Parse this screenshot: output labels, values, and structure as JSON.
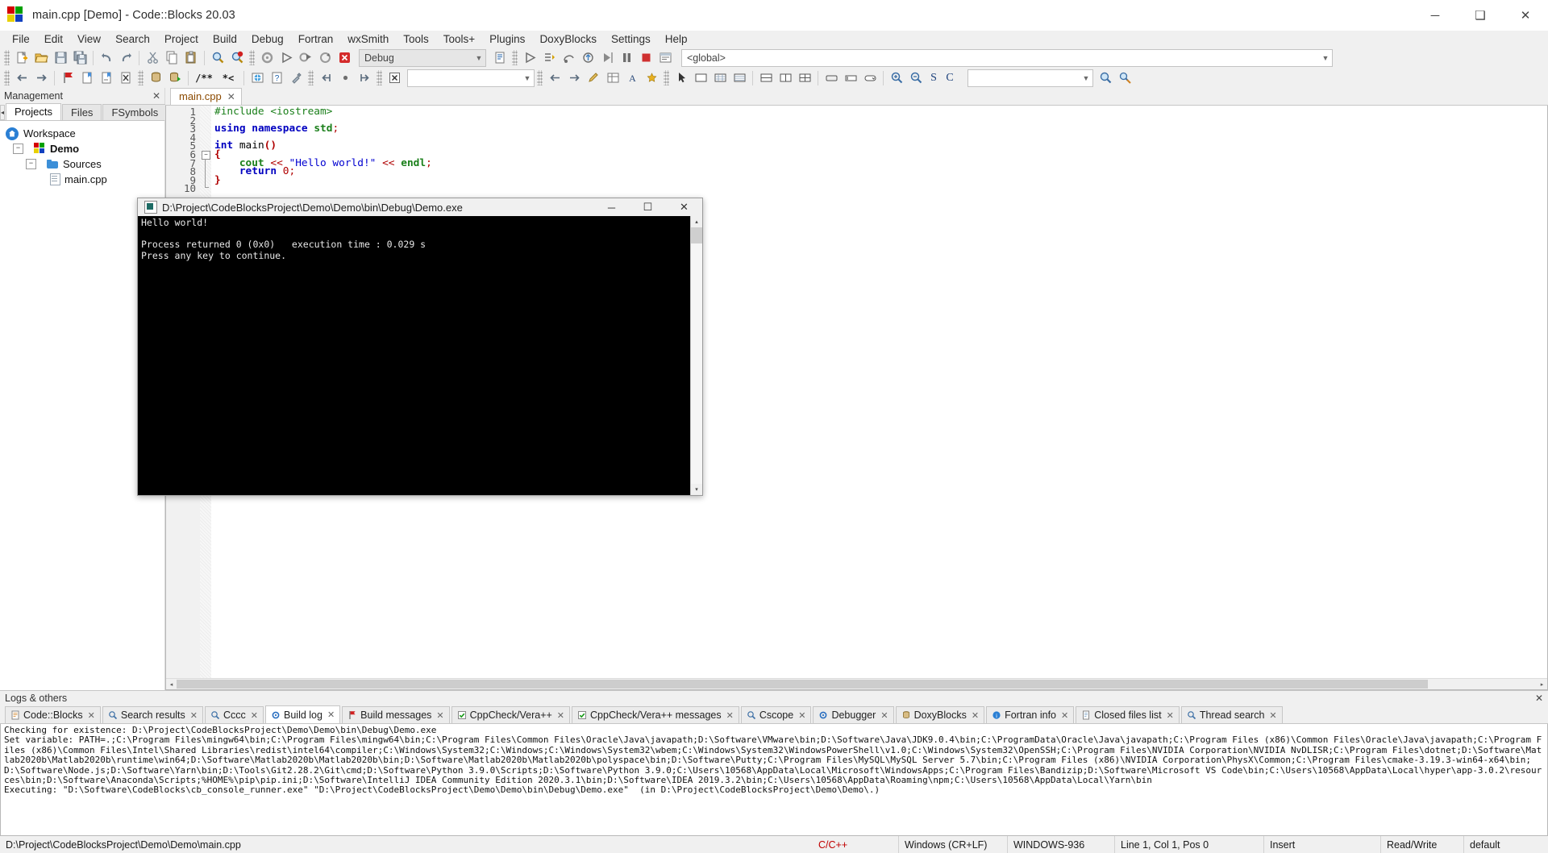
{
  "window": {
    "title": "main.cpp [Demo] - Code::Blocks 20.03",
    "app_icon": "codeblocks-logo-icon",
    "minimize_label": "─",
    "maximize_label": "❑",
    "close_label": "✕"
  },
  "menubar": {
    "items": [
      {
        "label": "File"
      },
      {
        "label": "Edit"
      },
      {
        "label": "View"
      },
      {
        "label": "Search"
      },
      {
        "label": "Project"
      },
      {
        "label": "Build"
      },
      {
        "label": "Debug"
      },
      {
        "label": "Fortran"
      },
      {
        "label": "wxSmith"
      },
      {
        "label": "Tools"
      },
      {
        "label": "Tools+"
      },
      {
        "label": "Plugins"
      },
      {
        "label": "DoxyBlocks"
      },
      {
        "label": "Settings"
      },
      {
        "label": "Help"
      }
    ]
  },
  "toolbar": {
    "build_target": "Debug",
    "scope": "<global>",
    "search_value": "",
    "goto_value": "",
    "row1_icons": [
      "new-file-icon",
      "open-file-icon",
      "save-icon",
      "save-all-icon",
      "undo-icon",
      "redo-icon",
      "cut-icon",
      "copy-icon",
      "paste-icon",
      "find-icon",
      "find-replace-icon",
      "build-icon",
      "run-icon",
      "build-and-run-icon",
      "rebuild-icon",
      "abort-icon",
      "build-target-list-icon",
      "debug-continue-icon",
      "debug-step-into-icon",
      "debug-next-line-icon",
      "debug-step-out-icon",
      "debug-run-to-cursor-icon",
      "debug-pause-icon",
      "debug-stop-icon",
      "debug-window-icon"
    ],
    "row2_icons": [
      "back-icon",
      "forward-icon",
      "bookmark-toggle-icon",
      "bookmark-prev-icon",
      "bookmark-next-icon",
      "bookmark-clear-icon",
      "doxyblocks-run-icon",
      "doxyblocks-extract-icon",
      "comment-block-icon",
      "uncomment-block-icon",
      "doxyblocks-html-icon",
      "doxyblocks-help-icon",
      "doxyblocks-config-icon",
      "fortran-jump-icon",
      "fortran-dot-icon",
      "fortran-forward-icon",
      "cancel-icon",
      "selection-pointer-icon",
      "panel-icon",
      "grid-icon",
      "layout-h-icon",
      "layout-v-icon",
      "layout-grid-icon",
      "button-icon",
      "textfield-icon",
      "combo-icon",
      "zoom-in-icon",
      "zoom-out-icon",
      "smallcaps-s-icon",
      "smallcaps-c-icon",
      "search-icon",
      "search-settings-icon"
    ]
  },
  "sidebar": {
    "header": "Management",
    "close_icon": "close-icon",
    "tabs": [
      {
        "label": "Projects",
        "active": true
      },
      {
        "label": "Files",
        "active": false
      },
      {
        "label": "FSymbols",
        "active": false
      }
    ],
    "tab_scroll_left": "◂",
    "tab_scroll_right": "▸",
    "tree": [
      {
        "label": "Workspace",
        "icon": "workspace-home-icon",
        "level": 0,
        "expander": "",
        "bold": false
      },
      {
        "label": "Demo",
        "icon": "project-icon",
        "level": 1,
        "expander": "−",
        "bold": true
      },
      {
        "label": "Sources",
        "icon": "folder-icon",
        "level": 2,
        "expander": "−",
        "bold": false
      },
      {
        "label": "main.cpp",
        "icon": "source-file-icon",
        "level": 3,
        "expander": "",
        "bold": false
      }
    ]
  },
  "editor": {
    "tab": {
      "label": "main.cpp",
      "close_icon": "close-icon"
    },
    "line_numbers": [
      "1",
      "2",
      "3",
      "4",
      "5",
      "6",
      "7",
      "8",
      "9",
      "10"
    ],
    "code_lines": [
      [
        {
          "t": "#include ",
          "c": "k-pre"
        },
        {
          "t": "<iostream>",
          "c": "k-pre"
        }
      ],
      [],
      [
        {
          "t": "using",
          "c": "k-kw"
        },
        {
          "t": " ",
          "c": "k-id"
        },
        {
          "t": "namespace",
          "c": "k-kw"
        },
        {
          "t": " ",
          "c": "k-id"
        },
        {
          "t": "std",
          "c": "k-std"
        },
        {
          "t": ";",
          "c": "k-op"
        }
      ],
      [],
      [
        {
          "t": "int",
          "c": "k-type"
        },
        {
          "t": " main",
          "c": "k-id"
        },
        {
          "t": "()",
          "c": "k-brace"
        }
      ],
      [
        {
          "t": "{",
          "c": "k-brace"
        }
      ],
      [
        {
          "t": "    cout",
          "c": "k-std"
        },
        {
          "t": " ",
          "c": "k-id"
        },
        {
          "t": "<<",
          "c": "k-op"
        },
        {
          "t": " ",
          "c": "k-id"
        },
        {
          "t": "\"Hello world!\"",
          "c": "k-str"
        },
        {
          "t": " ",
          "c": "k-id"
        },
        {
          "t": "<<",
          "c": "k-op"
        },
        {
          "t": " ",
          "c": "k-id"
        },
        {
          "t": "endl",
          "c": "k-std"
        },
        {
          "t": ";",
          "c": "k-op"
        }
      ],
      [
        {
          "t": "    ",
          "c": "k-id"
        },
        {
          "t": "return",
          "c": "k-kw"
        },
        {
          "t": " ",
          "c": "k-id"
        },
        {
          "t": "0",
          "c": "k-num"
        },
        {
          "t": ";",
          "c": "k-op"
        }
      ],
      [
        {
          "t": "}",
          "c": "k-brace"
        }
      ],
      []
    ],
    "hscroll": {
      "left_arrow": "◂",
      "right_arrow": "▸"
    }
  },
  "console": {
    "title": "D:\\Project\\CodeBlocksProject\\Demo\\Demo\\bin\\Debug\\Demo.exe",
    "app_icon": "console-app-icon",
    "minimize_label": "─",
    "maximize_label": "☐",
    "close_label": "✕",
    "output": "Hello world!\n\nProcess returned 0 (0x0)   execution time : 0.029 s\nPress any key to continue.",
    "scroll_up": "▴",
    "scroll_down": "▾"
  },
  "logs": {
    "header": "Logs & others",
    "close_icon": "close-icon",
    "tabs": [
      {
        "label": "Code::Blocks",
        "icon": "notes-icon",
        "active": false
      },
      {
        "label": "Search results",
        "icon": "search-icon",
        "active": false
      },
      {
        "label": "Cccc",
        "icon": "search-icon",
        "active": false
      },
      {
        "label": "Build log",
        "icon": "gear-icon",
        "active": true
      },
      {
        "label": "Build messages",
        "icon": "flag-icon",
        "active": false
      },
      {
        "label": "CppCheck/Vera++",
        "icon": "check-icon",
        "active": false
      },
      {
        "label": "CppCheck/Vera++ messages",
        "icon": "check-icon",
        "active": false
      },
      {
        "label": "Cscope",
        "icon": "search-icon",
        "active": false
      },
      {
        "label": "Debugger",
        "icon": "gear-icon",
        "active": false
      },
      {
        "label": "DoxyBlocks",
        "icon": "doxy-icon",
        "active": false
      },
      {
        "label": "Fortran info",
        "icon": "info-icon",
        "active": false
      },
      {
        "label": "Closed files list",
        "icon": "file-icon",
        "active": false
      },
      {
        "label": "Thread search",
        "icon": "search-icon",
        "active": false
      }
    ],
    "content": "Checking for existence: D:\\Project\\CodeBlocksProject\\Demo\\Demo\\bin\\Debug\\Demo.exe\nSet variable: PATH=.;C:\\Program Files\\mingw64\\bin;C:\\Program Files\\mingw64\\bin;C:\\Program Files\\Common Files\\Oracle\\Java\\javapath;D:\\Software\\VMware\\bin;D:\\Software\\Java\\JDK9.0.4\\bin;C:\\ProgramData\\Oracle\\Java\\javapath;C:\\Program Files (x86)\\Common Files\\Oracle\\Java\\javapath;C:\\Program Files (x86)\\Common Files\\Intel\\Shared Libraries\\redist\\intel64\\compiler;C:\\Windows\\System32;C:\\Windows;C:\\Windows\\System32\\wbem;C:\\Windows\\System32\\WindowsPowerShell\\v1.0;C:\\Windows\\System32\\OpenSSH;C:\\Program Files\\NVIDIA Corporation\\NVIDIA NvDLISR;C:\\Program Files\\dotnet;D:\\Software\\Matlab2020b\\Matlab2020b\\runtime\\win64;D:\\Software\\Matlab2020b\\Matlab2020b\\bin;D:\\Software\\Matlab2020b\\Matlab2020b\\polyspace\\bin;D:\\Software\\Putty;C:\\Program Files\\MySQL\\MySQL Server 5.7\\bin;C:\\Program Files (x86)\\NVIDIA Corporation\\PhysX\\Common;C:\\Program Files\\cmake-3.19.3-win64-x64\\bin;D:\\Software\\Node.js;D:\\Software\\Yarn\\bin;D:\\Tools\\Git2.28.2\\Git\\cmd;D:\\Software\\Python 3.9.0\\Scripts;D:\\Software\\Python 3.9.0;C:\\Users\\10568\\AppData\\Local\\Microsoft\\WindowsApps;C:\\Program Files\\Bandizip;D:\\Software\\Microsoft VS Code\\bin;C:\\Users\\10568\\AppData\\Local\\hyper\\app-3.0.2\\resources\\bin;D:\\Software\\Anaconda\\Scripts;%HOME%\\pip\\pip.ini;D:\\Software\\IntelliJ IDEA Community Edition 2020.3.1\\bin;D:\\Software\\IDEA 2019.3.2\\bin;C:\\Users\\10568\\AppData\\Roaming\\npm;C:\\Users\\10568\\AppData\\Local\\Yarn\\bin\nExecuting: \"D:\\Software\\CodeBlocks\\cb_console_runner.exe\" \"D:\\Project\\CodeBlocksProject\\Demo\\Demo\\bin\\Debug\\Demo.exe\"  (in D:\\Project\\CodeBlocksProject\\Demo\\Demo\\.)"
  },
  "status": {
    "path": "D:\\Project\\CodeBlocksProject\\Demo\\Demo\\main.cpp",
    "language": "C/C++",
    "eol": "Windows (CR+LF)",
    "encoding": "WINDOWS-936",
    "caret": "Line 1, Col 1, Pos 0",
    "insert_mode": "Insert",
    "rw": "Read/Write",
    "profile": "default"
  },
  "colors": {
    "window_bg": "#f0f0f0",
    "editor_bg": "#ffffff",
    "console_bg": "#000000",
    "accent": "#2a7fd4",
    "keyword": "#0000c0",
    "string": "#0000d0",
    "preproc": "#1a7f1a",
    "operator": "#b00000"
  }
}
